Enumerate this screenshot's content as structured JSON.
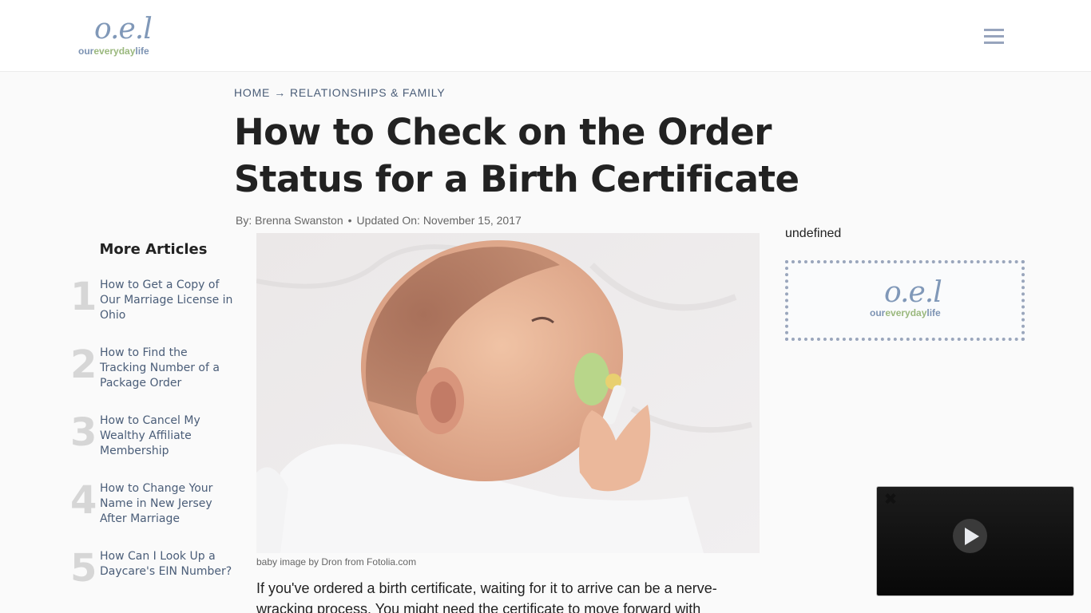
{
  "header": {
    "logo": {
      "mark": "o.e.l",
      "word_a": "our",
      "word_b": "everyday",
      "word_c": "life"
    },
    "menu_icon": "hamburger-menu-icon"
  },
  "breadcrumb": {
    "items": [
      "HOME",
      "RELATIONSHIPS & FAMILY"
    ],
    "separator": "→"
  },
  "article": {
    "title": "How to Check on the Order Status for a Birth Certificate",
    "byline": {
      "author": "By: Brenna Swanston",
      "separator": "•",
      "updated": "Updated On: November 15, 2017"
    },
    "image_alt": "baby with green pacifier",
    "caption": "baby image by Dron from Fotolia.com",
    "body_start": "If you've ordered a birth certificate, waiting for it to arrive can be a nerve-wracking process. You might need the certificate to move forward with"
  },
  "more_articles": {
    "heading": "More Articles",
    "items": [
      {
        "num": "1",
        "title": "How to Get a Copy of Our Marriage License in Ohio"
      },
      {
        "num": "2",
        "title": "How to Find the Tracking Number of a Package Order"
      },
      {
        "num": "3",
        "title": "How to Cancel My Wealthy Affiliate Membership"
      },
      {
        "num": "4",
        "title": "How to Change Your Name in New Jersey After Marriage"
      },
      {
        "num": "5",
        "title": "How Can I Look Up a Daycare's EIN Number?"
      }
    ]
  },
  "sidebar": {
    "undefined_label": "undefined",
    "ad_logo": {
      "mark": "o.e.l",
      "word_a": "our",
      "word_b": "everyday",
      "word_c": "life"
    }
  },
  "video": {
    "close_glyph": "✖"
  },
  "colors": {
    "brand_blue": "#8098b8",
    "brand_green": "#9ab87d",
    "link": "#4a5d78",
    "title": "#222222"
  }
}
